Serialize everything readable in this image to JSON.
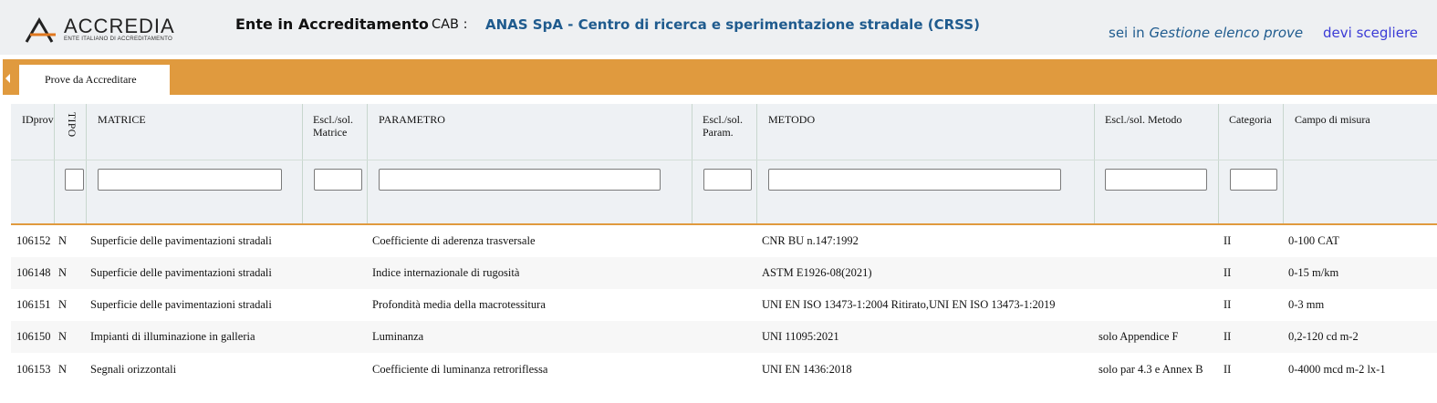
{
  "header": {
    "logo_text": "ACCREDIA",
    "logo_subtext": "ENTE ITALIANO DI ACCREDITAMENTO",
    "ente_title": "Ente in Accreditamento",
    "cab_label": "CAB :",
    "cab_value": "ANAS SpA - Centro di ricerca e sperimentazione stradale (CRSS)",
    "location_prefix": "sei in",
    "location_page": "Gestione elenco prove",
    "devi_scegliere": "devi scegliere"
  },
  "tabs": [
    {
      "label": "Prove da Accreditare",
      "active": true
    }
  ],
  "table": {
    "columns": [
      {
        "key": "id",
        "label": "IDprova"
      },
      {
        "key": "tipo",
        "label": "TIPO"
      },
      {
        "key": "matrice",
        "label": "MATRICE"
      },
      {
        "key": "escl_matrice",
        "label": "Escl./sol. Matrice",
        "label_line1": "Escl./sol.",
        "label_line2": "Matrice"
      },
      {
        "key": "parametro",
        "label": "PARAMETRO"
      },
      {
        "key": "escl_param",
        "label": "Escl./sol. Param.",
        "label_line1": "Escl./sol.",
        "label_line2": "Param."
      },
      {
        "key": "metodo",
        "label": "METODO"
      },
      {
        "key": "escl_metodo",
        "label": "Escl./sol. Metodo"
      },
      {
        "key": "categoria",
        "label": "Categoria"
      },
      {
        "key": "campo",
        "label": "Campo di misura"
      }
    ],
    "filters": {
      "tipo": "",
      "matrice": "",
      "escl_matrice": "",
      "parametro": "",
      "escl_param": "",
      "metodo": "",
      "escl_metodo": "",
      "categoria": ""
    },
    "rows": [
      {
        "id": "106152",
        "tipo": "N",
        "matrice": "Superficie delle pavimentazioni stradali",
        "escl_matrice": "",
        "parametro": "Coefficiente di aderenza trasversale",
        "escl_param": "",
        "metodo": "CNR BU n.147:1992",
        "escl_metodo": "",
        "categoria": "II",
        "campo": "0-100 CAT"
      },
      {
        "id": "106148",
        "tipo": "N",
        "matrice": "Superficie delle pavimentazioni stradali",
        "escl_matrice": "",
        "parametro": "Indice internazionale di rugosità",
        "escl_param": "",
        "metodo": "ASTM E1926-08(2021)",
        "escl_metodo": "",
        "categoria": "II",
        "campo": "0-15 m/km"
      },
      {
        "id": "106151",
        "tipo": "N",
        "matrice": "Superficie delle pavimentazioni stradali",
        "escl_matrice": "",
        "parametro": "Profondità media della macrotessitura",
        "escl_param": "",
        "metodo": "UNI EN ISO 13473-1:2004 Ritirato,UNI EN ISO 13473-1:2019",
        "escl_metodo": "",
        "categoria": "II",
        "campo": "0-3 mm"
      },
      {
        "id": "106150",
        "tipo": "N",
        "matrice": "Impianti di illuminazione in galleria",
        "escl_matrice": "",
        "parametro": "Luminanza",
        "escl_param": "",
        "metodo": "UNI 11095:2021",
        "escl_metodo": "solo Appendice F",
        "categoria": "II",
        "campo": "0,2-120 cd m-2"
      },
      {
        "id": "106153",
        "tipo": "N",
        "matrice": "Segnali orizzontali",
        "escl_matrice": "",
        "parametro": "Coefficiente di luminanza retroriflessa",
        "escl_param": "",
        "metodo": "UNI EN 1436:2018",
        "escl_metodo": "solo par 4.3 e Annex B",
        "categoria": "II",
        "campo": "0-4000 mcd m-2 lx-1"
      }
    ]
  }
}
